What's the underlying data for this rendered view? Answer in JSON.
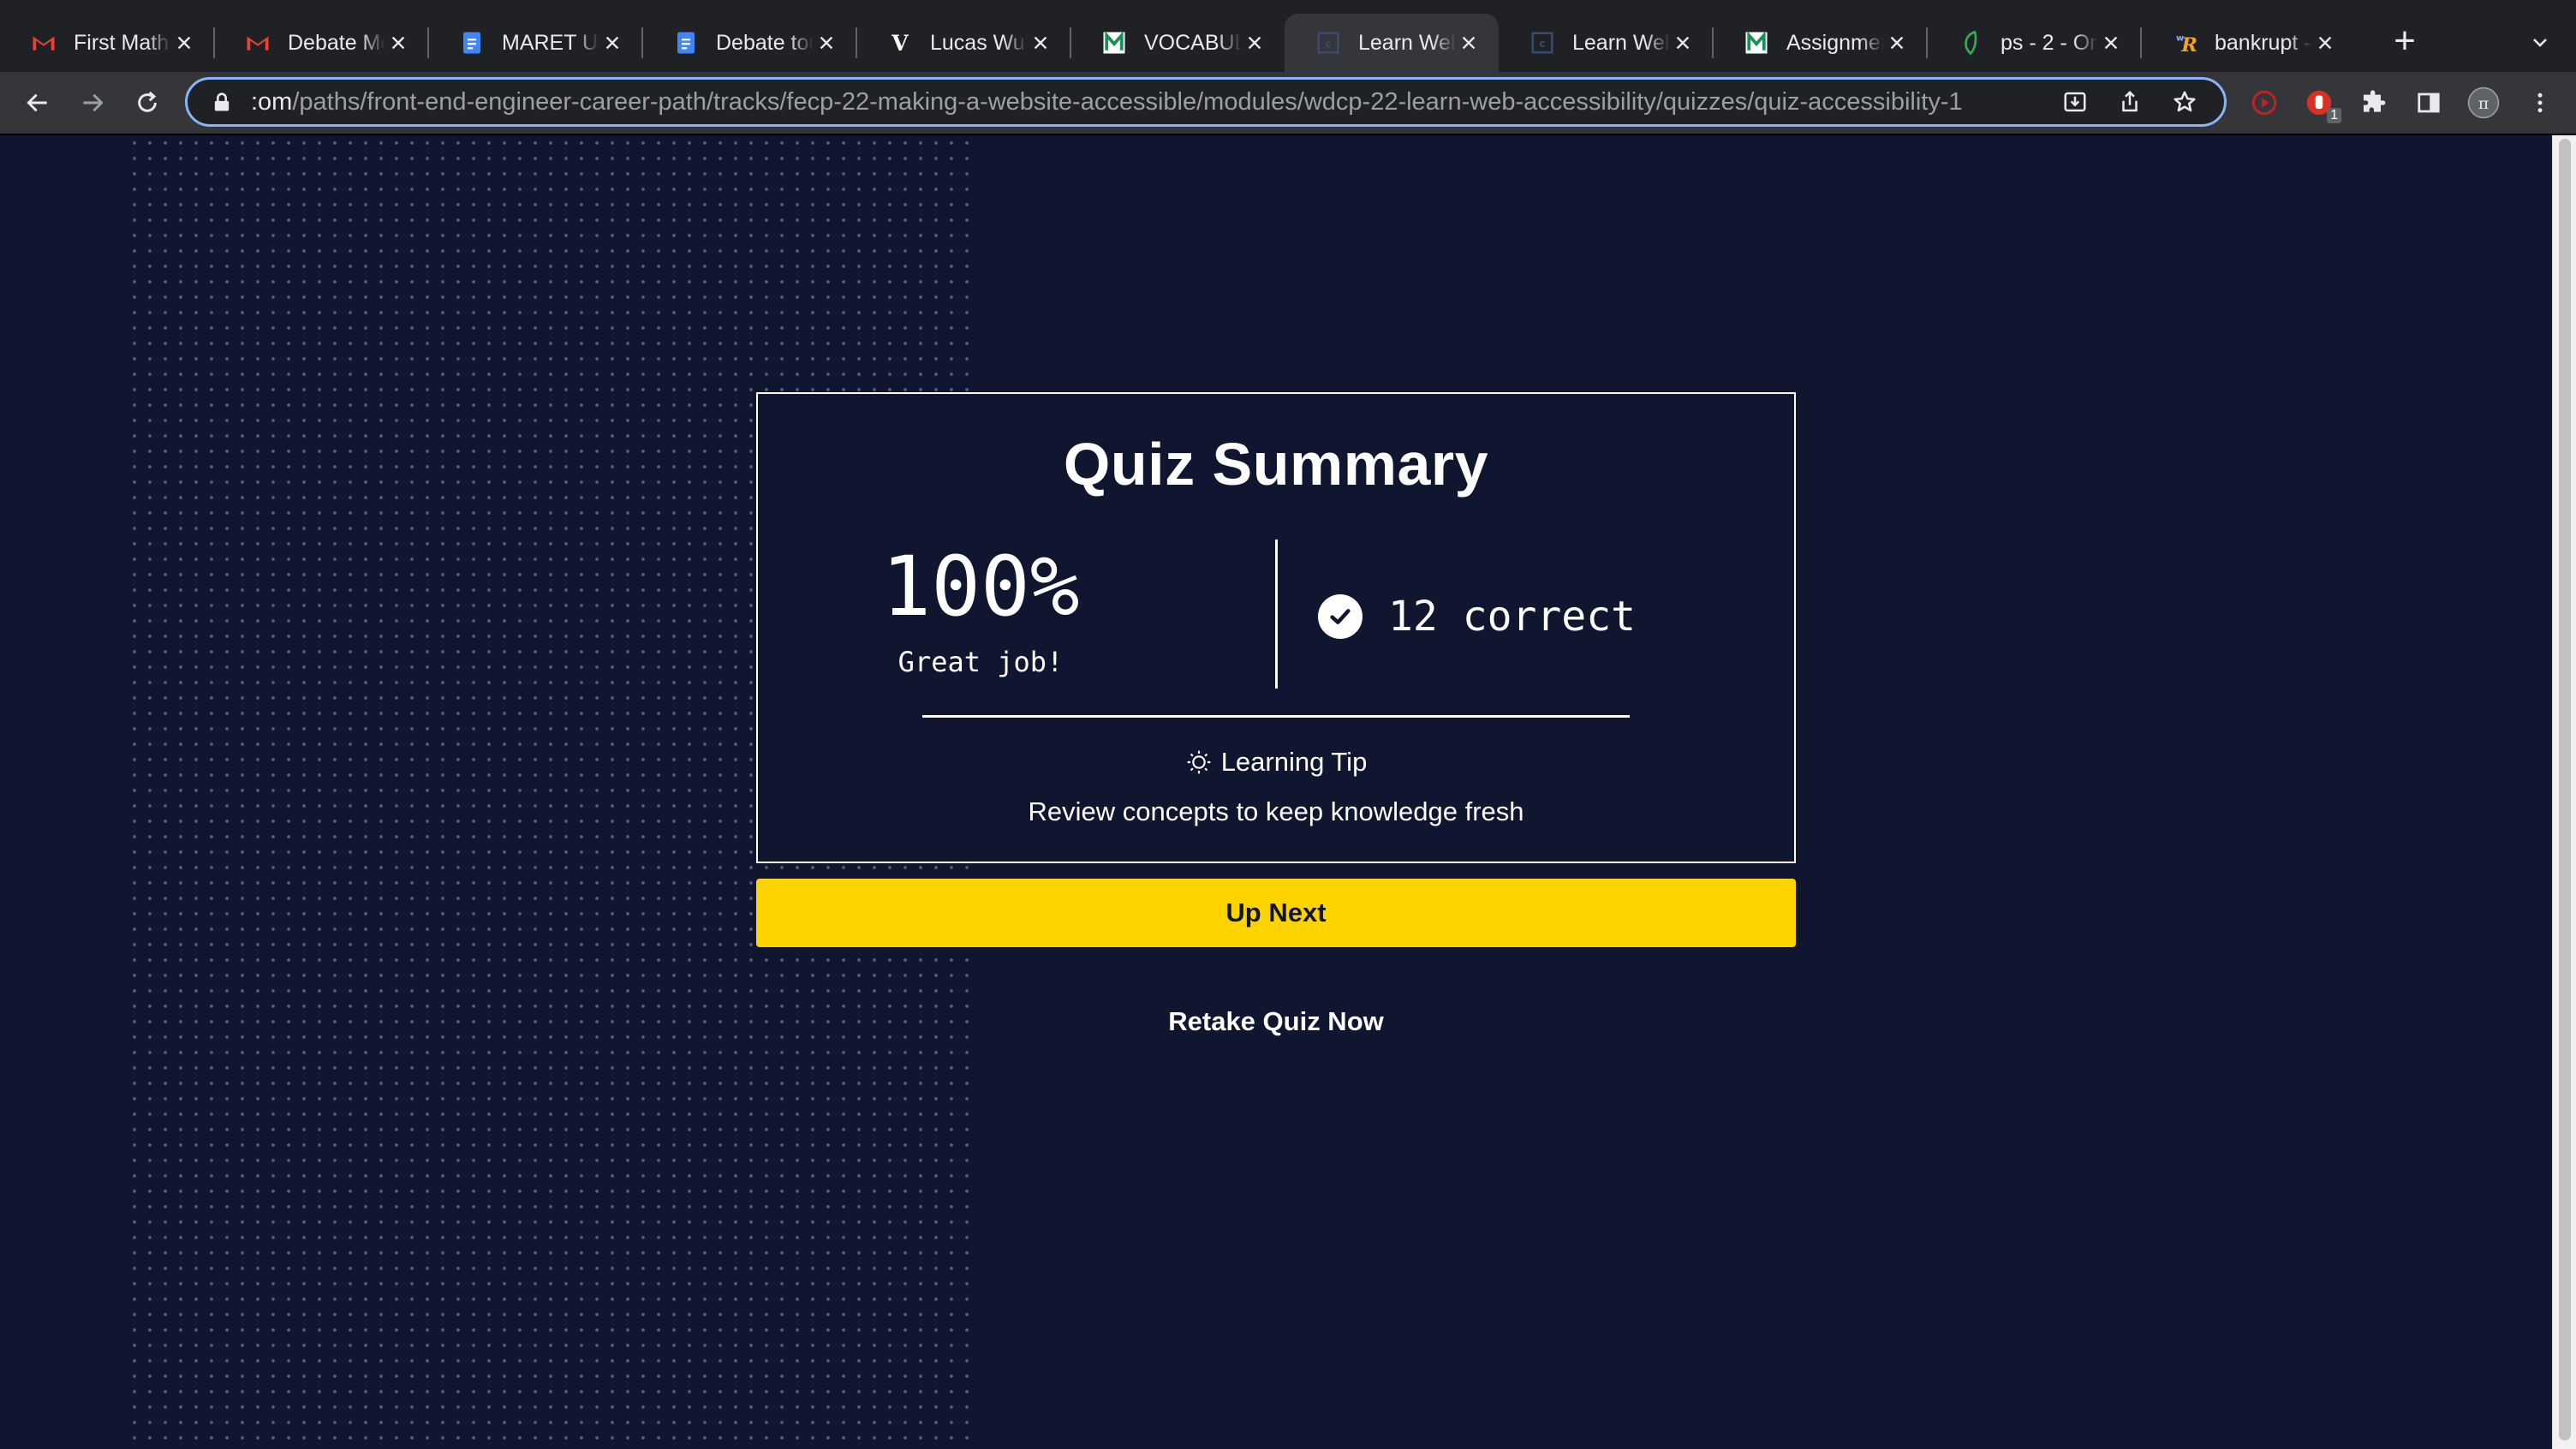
{
  "browser": {
    "tabs": [
      {
        "title": "First Math",
        "icon": "gmail-icon",
        "icon_color": "#ea4335"
      },
      {
        "title": "Debate Me",
        "icon": "gmail-icon",
        "icon_color": "#ea4335"
      },
      {
        "title": "MARET UP",
        "icon": "google-docs-icon",
        "icon_color": "#4285f4"
      },
      {
        "title": "Debate tou",
        "icon": "google-docs-icon",
        "icon_color": "#4285f4"
      },
      {
        "title": "Lucas Wu'",
        "icon": "v-icon",
        "icon_color": "#ffffff"
      },
      {
        "title": "VOCABUL/",
        "icon": "m-icon",
        "icon_color": "#1a8f5a"
      },
      {
        "title": "Learn Web",
        "icon": "codecademy-icon",
        "icon_color": "#3a4a6b",
        "active": true
      },
      {
        "title": "Learn Web",
        "icon": "codecademy-icon",
        "icon_color": "#3a4a6b"
      },
      {
        "title": "Assignmen",
        "icon": "m-icon",
        "icon_color": "#1a8f5a"
      },
      {
        "title": "ps - 2 - Or",
        "icon": "leaf-icon",
        "icon_color": "#34a853"
      },
      {
        "title": "bankrupt -",
        "icon": "r-icon",
        "icon_color": "#f4a226"
      }
    ],
    "url_prefix": ":om",
    "url_path": "/paths/front-end-engineer-career-path/tracks/fecp-22-making-a-website-accessible/modules/wdcp-22-learn-web-accessibility/quizzes/quiz-accessibility-1",
    "extension_badge": "1"
  },
  "quiz": {
    "title": "Quiz Summary",
    "score": "100%",
    "score_caption": "Great job!",
    "correct_text": "12 correct",
    "tip_title": "Learning Tip",
    "tip_body": "Review concepts to keep knowledge fresh",
    "next_label": "Up Next",
    "retake_label": "Retake Quiz Now"
  },
  "colors": {
    "page_bg": "#10162f",
    "accent_yellow": "#ffd300"
  }
}
